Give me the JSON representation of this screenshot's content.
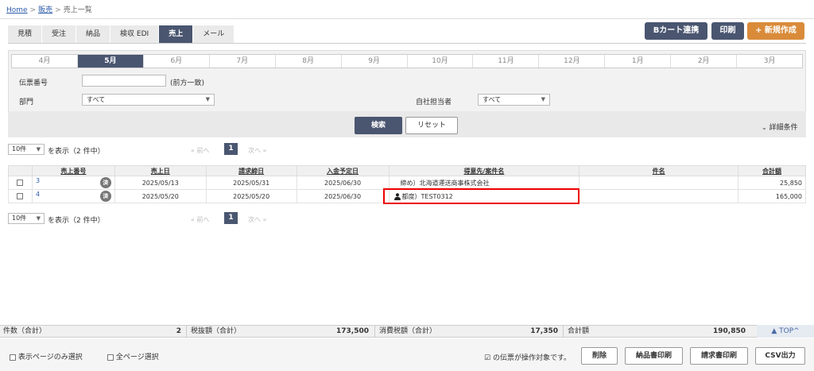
{
  "breadcrumb": {
    "home": "Home",
    "sales": "販売",
    "current": "売上一覧",
    "sep": ">"
  },
  "tabs": [
    {
      "label": "見積"
    },
    {
      "label": "受注"
    },
    {
      "label": "納品"
    },
    {
      "label": "検収 EDI"
    },
    {
      "label": "売上"
    },
    {
      "label": "メール"
    }
  ],
  "actions": {
    "cart": "Bカート連携",
    "print": "印刷",
    "new": "+ 新規作成"
  },
  "months": [
    "4月",
    "5月",
    "6月",
    "7月",
    "8月",
    "9月",
    "10月",
    "11月",
    "12月",
    "1月",
    "2月",
    "3月"
  ],
  "filters": {
    "slip_no_label": "伝票番号",
    "slip_no_value": "",
    "slip_no_hint": "(前方一致)",
    "dept_label": "部門",
    "dept_value": "すべて",
    "staff_label": "自社担当者",
    "staff_value": "すべて",
    "search": "検索",
    "reset": "リセット",
    "detail": "詳細条件"
  },
  "paging": {
    "per_page": "10件",
    "display_text": "を表示（2 件中）",
    "prev": "« 前へ",
    "page": "1",
    "next": "次へ »"
  },
  "table": {
    "headers": [
      "売上番号",
      "売上日",
      "請求締日",
      "入金予定日",
      "得意先/案件名",
      "件名",
      "合計額"
    ],
    "rows": [
      {
        "no": "3",
        "badge": "済",
        "sales_date": "2025/05/13",
        "bill_close": "2025/05/31",
        "pay_date": "2025/06/30",
        "customer": "締め）北海道運送商事株式会社",
        "subject": "",
        "total": "25,850"
      },
      {
        "no": "4",
        "badge": "済",
        "sales_date": "2025/05/20",
        "bill_close": "2025/05/20",
        "pay_date": "2025/06/30",
        "customer": "都度）TEST0312",
        "subject": "",
        "total": "165,000"
      }
    ]
  },
  "totals": {
    "count_label": "件数（合計）",
    "count_value": "2",
    "pretax_label": "税抜額（合計）",
    "pretax_value": "173,500",
    "tax_label": "消費税額（合計）",
    "tax_value": "17,350",
    "total_label": "合計額",
    "total_value": "190,850",
    "top": "TOP"
  },
  "bottom": {
    "select_page": "表示ページのみ選択",
    "select_all": "全ページ選択",
    "note": "の伝票が操作対象です。",
    "delete": "削除",
    "delivery_print": "納品書印刷",
    "invoice_print": "請求書印刷",
    "csv": "CSV出力"
  },
  "colors": {
    "primary": "#4a5670",
    "accent": "#d98b3a",
    "highlight": "#e00000",
    "link": "#2b5aa8"
  }
}
